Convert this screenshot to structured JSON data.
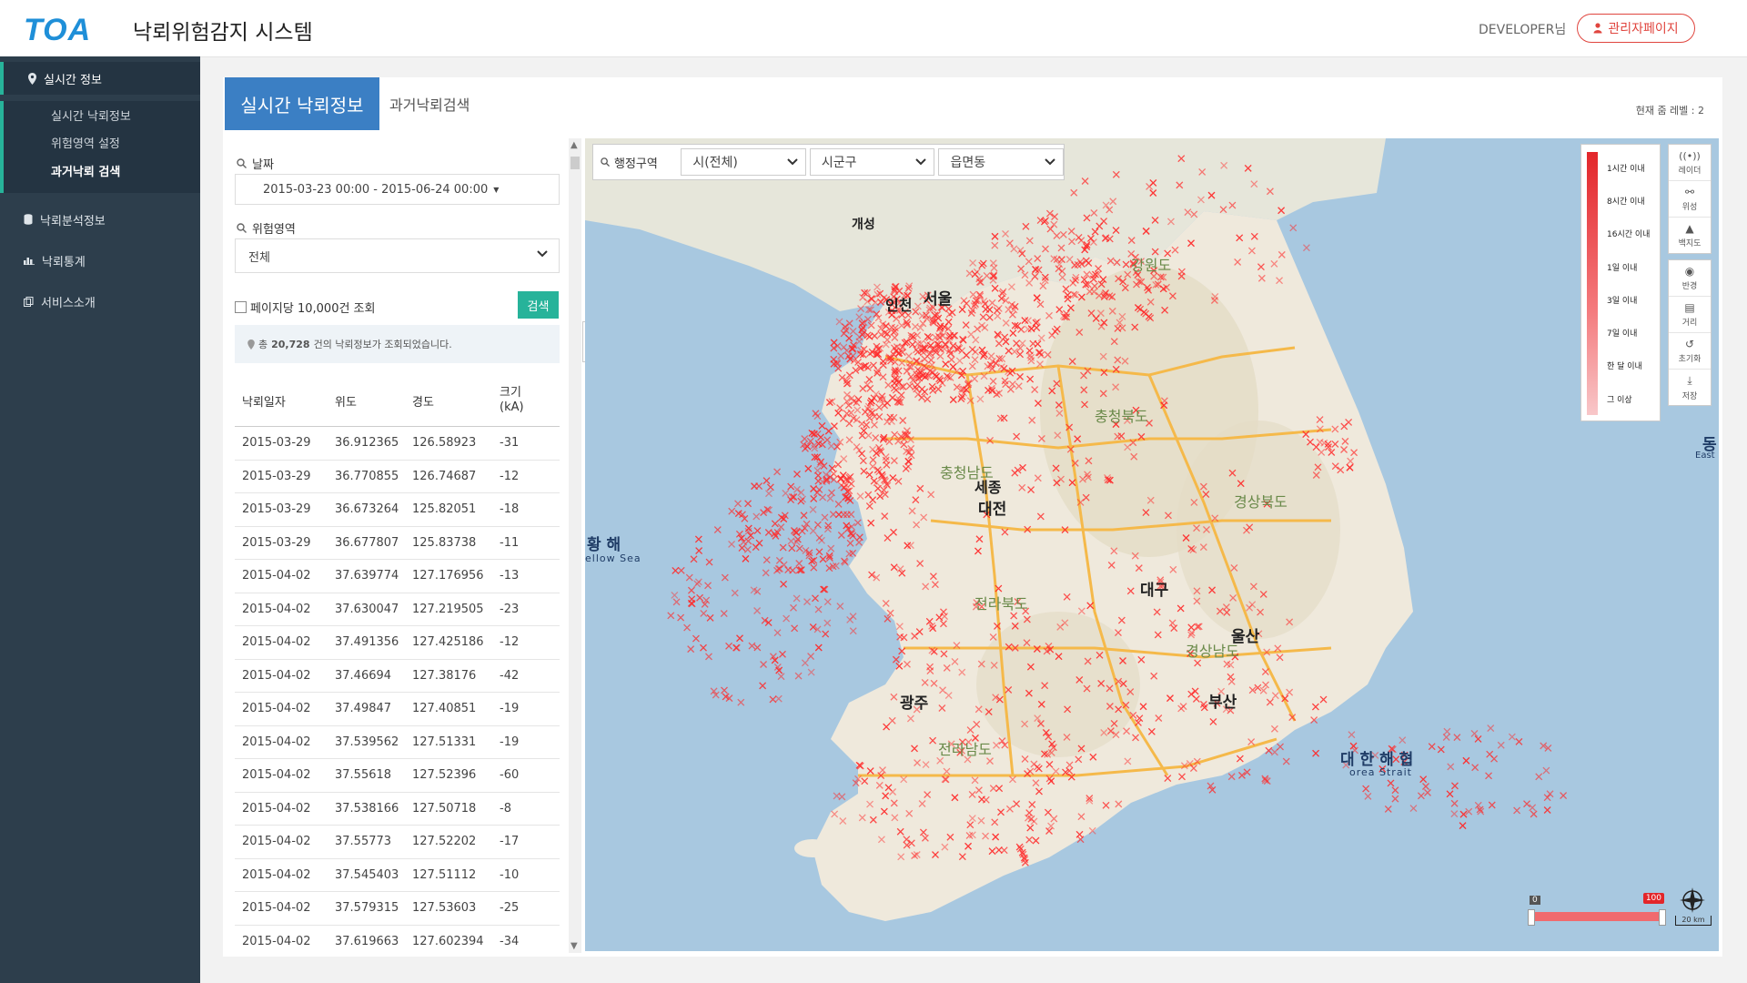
{
  "header": {
    "logo": "TOA",
    "title": "낙뢰위험감지 시스템",
    "user": "DEVELOPER님",
    "admin_button": "관리자페이지"
  },
  "sidebar": {
    "realtime": "실시간 정보",
    "sub_items": [
      "실시간 낙뢰정보",
      "위험영역 설정",
      "과거낙뢰 검색"
    ],
    "analysis": "낙뢰분석정보",
    "stats": "낙뢰통계",
    "intro": "서비스소개"
  },
  "tabs": {
    "active": "실시간 낙뢰정보",
    "other": "과거낙뢰검색",
    "zoom_level": "현재 줌 레벨 : 2"
  },
  "search": {
    "date_label": "날짜",
    "date_value": "2015-03-23 00:00 - 2015-06-24 00:00",
    "area_label": "위험영역",
    "area_value": "전체",
    "page_option": "페이지당 10,000건 조회",
    "search_button": "검색",
    "result_prefix": "총",
    "result_count": "20,728",
    "result_suffix": "건의 낙뢰정보가 조회되었습니다."
  },
  "table": {
    "headers": [
      "낙뢰일자",
      "위도",
      "경도",
      "크기",
      "(kA)"
    ],
    "rows": [
      [
        "2015-03-29",
        "36.912365",
        "126.58923",
        "-31"
      ],
      [
        "2015-03-29",
        "36.770855",
        "126.74687",
        "-12"
      ],
      [
        "2015-03-29",
        "36.673264",
        "125.82051",
        "-18"
      ],
      [
        "2015-03-29",
        "36.677807",
        "125.83738",
        "-11"
      ],
      [
        "2015-04-02",
        "37.639774",
        "127.176956",
        "-13"
      ],
      [
        "2015-04-02",
        "37.630047",
        "127.219505",
        "-23"
      ],
      [
        "2015-04-02",
        "37.491356",
        "127.425186",
        "-12"
      ],
      [
        "2015-04-02",
        "37.46694",
        "127.38176",
        "-42"
      ],
      [
        "2015-04-02",
        "37.49847",
        "127.40851",
        "-19"
      ],
      [
        "2015-04-02",
        "37.539562",
        "127.51331",
        "-19"
      ],
      [
        "2015-04-02",
        "37.55618",
        "127.52396",
        "-60"
      ],
      [
        "2015-04-02",
        "37.538166",
        "127.50718",
        "-8"
      ],
      [
        "2015-04-02",
        "37.55773",
        "127.52202",
        "-17"
      ],
      [
        "2015-04-02",
        "37.545403",
        "127.51112",
        "-10"
      ],
      [
        "2015-04-02",
        "37.579315",
        "127.53603",
        "-25"
      ],
      [
        "2015-04-02",
        "37.619663",
        "127.602394",
        "-34"
      ]
    ]
  },
  "map": {
    "admin_label": "행정구역",
    "sido": "시(전체)",
    "sigungu": "시군구",
    "eupmyeondong": "읍면동",
    "legend": [
      "1시간 이내",
      "8시간 이내",
      "16시간 이내",
      "1일 이내",
      "3일 이내",
      "7일 이내",
      "한 달 이내",
      "그 이상"
    ],
    "tools_top": [
      "레이더",
      "위성",
      "백지도"
    ],
    "tools_bottom": [
      "반경",
      "거리",
      "초기화",
      "저장"
    ],
    "labels": {
      "seoul": "서울",
      "incheon": "인천",
      "daejeon": "대전",
      "daegu": "대구",
      "gwangju": "광주",
      "ulsan": "울산",
      "busan": "부산",
      "sejong": "세종",
      "gaeseong": "개성",
      "gangwon": "강원도",
      "chungbuk": "충청북도",
      "chungnam": "충청남도",
      "gyeongbuk": "경상북도",
      "gyeongnam": "경상남도",
      "jeonbuk": "전라북도",
      "jeonnam": "전라남도",
      "yellow_sea_ko": "황 해",
      "yellow_sea_en": "ellow Sea",
      "korea_strait_ko": "대 한 해 협",
      "korea_strait_en": "orea Strait",
      "east_ko": "동",
      "east_en": "East"
    },
    "scale": "20 km",
    "slider_min": "0",
    "slider_max": "100",
    "land_color": "#efe9dc",
    "sea_color": "#a8c8e0",
    "strike_color": "#ff2a2a"
  }
}
